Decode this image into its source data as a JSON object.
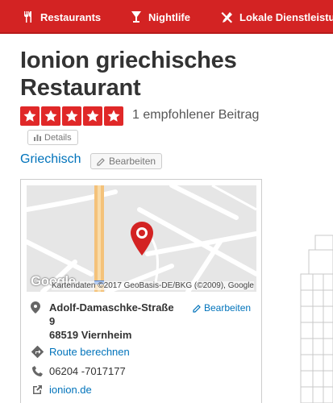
{
  "nav": {
    "items": [
      {
        "label": "Restaurants",
        "icon": "fork-knife-icon"
      },
      {
        "label": "Nightlife",
        "icon": "cocktail-icon"
      },
      {
        "label": "Lokale Dienstleistungen",
        "icon": "tools-icon"
      }
    ]
  },
  "business": {
    "name": "Ionion griechisches Restaurant",
    "rating": 5,
    "review_count": "1 empfohlener Beitrag",
    "details_label": "Details",
    "category": "Griechisch",
    "edit_label": "Bearbeiten"
  },
  "map": {
    "attribution": "Kartendaten ©2017 GeoBasis-DE/BKG (©2009), Google",
    "logo": "Google"
  },
  "contact": {
    "street": "Adolf-Damaschke-Straße",
    "number": "9",
    "city": "68519 Viernheim",
    "edit_label": "Bearbeiten",
    "route_label": "Route berechnen",
    "phone": "06204 -7017177",
    "website": "ionion.de"
  },
  "colors": {
    "brand_red": "#d32323",
    "star_red": "#e02828",
    "link_blue": "#0073bb"
  }
}
